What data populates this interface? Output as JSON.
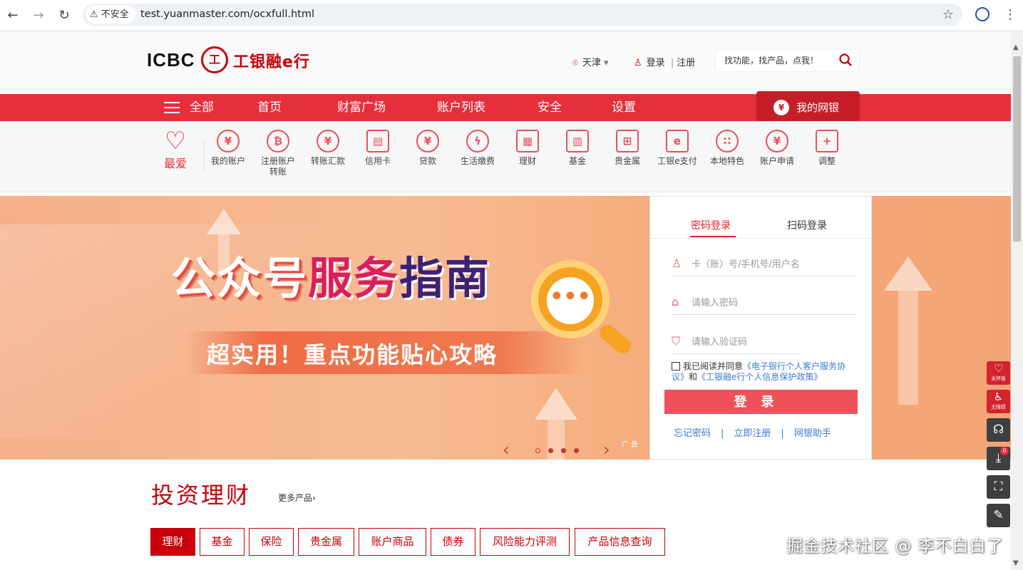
{
  "browser": {
    "security_label": "不安全",
    "url": "test.yuanmaster.com/ocxfull.html"
  },
  "header": {
    "logo_icbc": "ICBC",
    "logo_seal": "工",
    "logo_text": "工银融e行",
    "location": "天津",
    "login": "登录",
    "register": "注册",
    "search_placeholder": "找功能，找产品，点我！"
  },
  "main_nav": {
    "all": "全部",
    "items": [
      "首页",
      "财富广场",
      "账户列表",
      "安全",
      "设置"
    ],
    "my_bank": "我的网银"
  },
  "quick": {
    "favorite": "最爱",
    "items": [
      {
        "label": "我的账户",
        "icon": "yen-icon"
      },
      {
        "label": "注册账户转账",
        "icon": "transfer-icon"
      },
      {
        "label": "转账汇款",
        "icon": "remit-icon"
      },
      {
        "label": "信用卡",
        "icon": "card-icon"
      },
      {
        "label": "贷款",
        "icon": "loan-bag-icon"
      },
      {
        "label": "生活缴费",
        "icon": "bolt-icon"
      },
      {
        "label": "理财",
        "icon": "abacus-icon"
      },
      {
        "label": "基金",
        "icon": "chart-icon"
      },
      {
        "label": "贵金属",
        "icon": "gold-icon"
      },
      {
        "label": "工银e支付",
        "icon": "pay-icon"
      },
      {
        "label": "本地特色",
        "icon": "local-icon"
      },
      {
        "label": "账户申请",
        "icon": "apply-icon"
      },
      {
        "label": "调整",
        "icon": "plus-icon"
      }
    ]
  },
  "banner": {
    "title_a": "公众号",
    "title_b": "服务",
    "title_c": "指南",
    "subtitle": "超实用！重点功能贴心攻略",
    "ad": "广告"
  },
  "login": {
    "tab_password": "密码登录",
    "tab_qr": "扫码登录",
    "account_placeholder": "卡（账）号/手机号/用户名",
    "password_placeholder": "请输入密码",
    "captcha_placeholder": "请输入验证码",
    "agree_prefix": "我已阅读并同意",
    "agree_link1": "《电子银行个人客户服务协议》",
    "agree_and": "和",
    "agree_link2": "《工银融e行个人信息保护政策》",
    "submit": "登录",
    "forgot": "忘记密码",
    "signup": "立即注册",
    "helper": "网银助手"
  },
  "invest": {
    "title": "投资理财",
    "more": "更多产品",
    "tabs": [
      "理财",
      "基金",
      "保险",
      "贵金属",
      "账户商品",
      "债券",
      "风险能力评测",
      "产品信息查询"
    ]
  },
  "side": {
    "care": "关怀版",
    "barrier_free": "无障碍",
    "badge": "0"
  },
  "watermark": "掘金技术社区 @ 李不白白了",
  "colors": {
    "brand_red": "#c7000b",
    "nav_red": "#e52f3b",
    "link_blue": "#3a7bd5"
  }
}
